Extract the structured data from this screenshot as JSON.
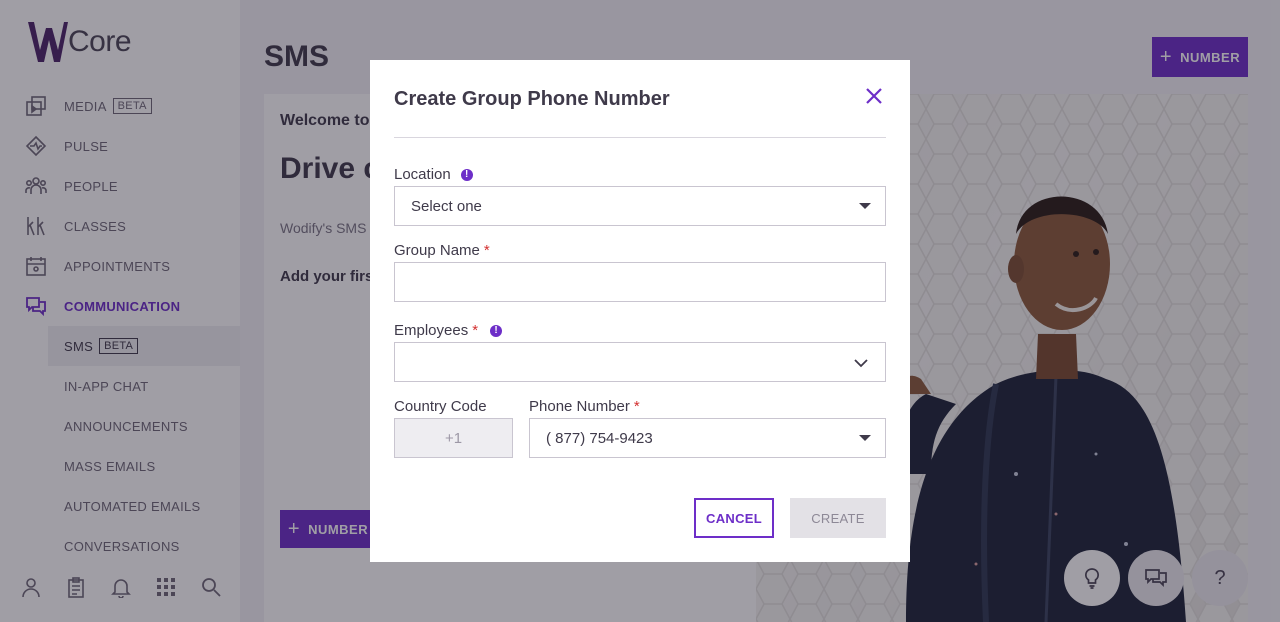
{
  "app": {
    "logo_text": "Core"
  },
  "sidebar": {
    "items": [
      {
        "label": "MEDIA",
        "badge": "BETA",
        "icon": "media-icon"
      },
      {
        "label": "PULSE",
        "icon": "pulse-icon"
      },
      {
        "label": "PEOPLE",
        "icon": "people-icon"
      },
      {
        "label": "CLASSES",
        "icon": "classes-icon"
      },
      {
        "label": "APPOINTMENTS",
        "icon": "calendar-icon"
      },
      {
        "label": "COMMUNICATION",
        "icon": "chat-icon",
        "active": true
      }
    ],
    "subitems": [
      {
        "label": "SMS",
        "badge": "BETA",
        "active": true
      },
      {
        "label": "IN-APP CHAT"
      },
      {
        "label": "ANNOUNCEMENTS"
      },
      {
        "label": "MASS EMAILS"
      },
      {
        "label": "AUTOMATED EMAILS"
      },
      {
        "label": "CONVERSATIONS"
      }
    ],
    "footer_icons": [
      "user-icon",
      "clipboard-icon",
      "bell-icon",
      "apps-grid-icon",
      "search-icon"
    ]
  },
  "main": {
    "title": "SMS",
    "top_button": "NUMBER",
    "welcome": "Welcome to",
    "headline": "Drive c connec text me clients",
    "description": "Wodify's SMS and clients, fo that build stro growth.",
    "add_first": "Add your first",
    "card_button": "NUMBER"
  },
  "modal": {
    "title": "Create Group Phone Number",
    "location": {
      "label": "Location",
      "value": "Select one"
    },
    "group_name": {
      "label": "Group Name",
      "required": "*",
      "value": ""
    },
    "employees": {
      "label": "Employees",
      "required": "*",
      "value": ""
    },
    "country_code": {
      "label": "Country Code",
      "value": "+1"
    },
    "phone_number": {
      "label": "Phone Number",
      "required": "*",
      "value": "( 877) 754-9423"
    },
    "cancel_label": "CANCEL",
    "create_label": "CREATE"
  },
  "fabs": {
    "help_label": "?"
  },
  "colors": {
    "accent": "#6d2ec8",
    "required": "#d32f2f"
  }
}
